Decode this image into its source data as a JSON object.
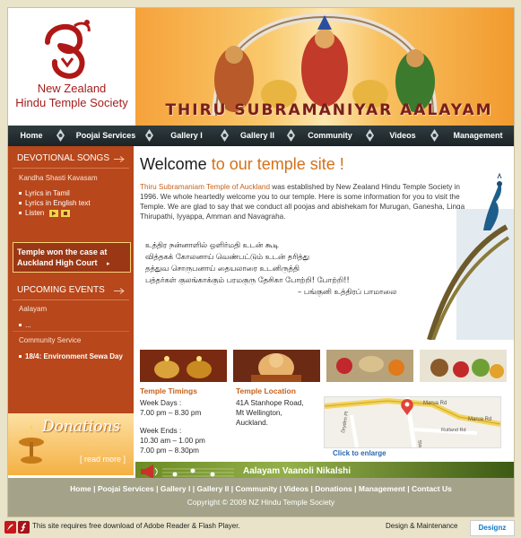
{
  "header": {
    "logo_line1": "New Zealand",
    "logo_line2": "Hindu Temple Society",
    "banner_title": "THIRU SUBRAMANIYAR AALAYAM"
  },
  "nav": {
    "items": [
      "Home",
      "Poojai Services",
      "Gallery I",
      "Gallery II",
      "Community",
      "Videos",
      "Management"
    ]
  },
  "sidebar": {
    "devotional_title": "DEVOTIONAL SONGS",
    "song_title": "Kandha Shasti Kavasam",
    "lyrics_tamil": "Lyrics in Tamil",
    "lyrics_english": "Lyrics in English text",
    "listen": "Listen",
    "case_text": "Temple won the case at Auckland High Court",
    "events_title": "UPCOMING EVENTS",
    "aalayam": "Aalayam",
    "aalayam_item": "...",
    "community": "Community Service",
    "community_item": "18/4: Environment Sewa Day",
    "donations": "Donations",
    "read_more": "[ read more ]"
  },
  "main": {
    "welcome_prefix": "Welcome",
    "welcome_suffix": "to our temple site !",
    "intro_highlight": "Thiru Subramaniam Temple of Auckland",
    "intro_rest": " was established by New Zealand Hindu Temple Society in 1996. We whole heartedly welcome you to our temple. Here is some information for you to visit the Temple. We are glad to say that we conduct all poojas and abishekam for Murugan, Ganesha, Linga Thirupathi, Iyyappa, Amman and Navagraha.",
    "tamil_lines": [
      "உத்திர நன்னாளில் ஒளிர்மதி உடன் கூடி",
      "வித்தகக் கோலனாய் வெண்பட்டும் உடன் தரித்து",
      "தத்துவ சொருபனாய் தையலாரை உடனிருத்தி",
      "பத்தர்கள் குலங்காக்கும் பரமகுரு தேசிகா போற்றி! போற்றி!!"
    ],
    "tamil_signature": "– பங்குனி உத்திரப் பாமாலை",
    "timings_title": "Temple Timings",
    "weekdays_label": "Week Days :",
    "weekdays_time": "7.00 pm – 8.30 pm",
    "weekends_label": "Week Ends :",
    "weekends_time1": "10.30 am – 1.00 pm",
    "weekends_time2": "7.00 pm – 8.30pm",
    "location_title": "Temple Location",
    "location_line1": "41A Stanhope Road,",
    "location_line2": "Mt Wellington,",
    "location_line3": "Auckland.",
    "map_roads": [
      "Marua Rd",
      "Marua Rd",
      "Stanhope Rd",
      "Rutland Rd",
      "Dryden Pl"
    ],
    "click_enlarge": "Click to enlarge",
    "vaanoli": "Aalayam Vaanoli Nikalshi"
  },
  "footer": {
    "links": [
      "Home",
      "Poojai Services",
      "Gallery I",
      "Gallery II",
      "Community",
      "Videos",
      "Donations",
      "Management",
      "Contact Us"
    ],
    "copyright": "Copyright © 2009 NZ Hindu Temple Society"
  },
  "bottom": {
    "note": "This site requires free download of Adobe Reader & Flash Player.",
    "design": "Design & Maintenance",
    "designer": "Designz"
  },
  "colors": {
    "nav_bg": "#1f2a2d",
    "sidebar_bg": "#b8471b",
    "accent_orange": "#d3711a",
    "logo_red": "#a51d1d",
    "footer_bg": "#a4a389"
  }
}
